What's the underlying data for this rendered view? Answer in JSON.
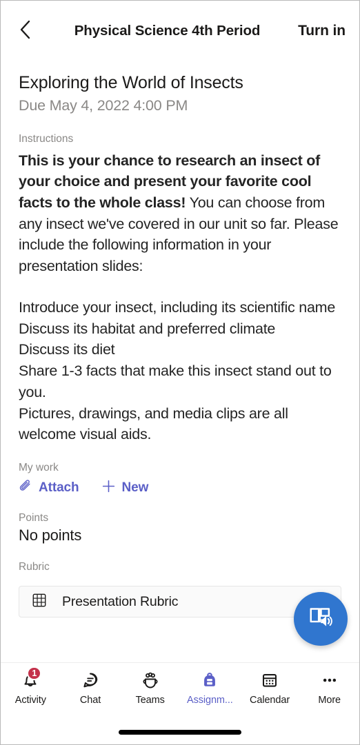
{
  "header": {
    "back_icon": "chevron-left-icon",
    "title": "Physical Science 4th Period",
    "turn_in_label": "Turn in"
  },
  "assignment": {
    "title": "Exploring the World of Insects",
    "due": "Due May 4, 2022 4:00 PM"
  },
  "instructions": {
    "label": "Instructions",
    "bold_text": "This is your chance to research an insect of your choice and present your favorite cool facts to the whole class!",
    "rest_text": " You can choose from any insect we've covered in our unit so far. Please include the following information in your presentation slides:",
    "list": [
      "Introduce your insect, including its scientific name",
      "Discuss its habitat and preferred climate",
      "Discuss its diet",
      "Share 1-3 facts that make this insect stand out to you.",
      "Pictures, drawings, and media clips are all welcome visual aids."
    ]
  },
  "my_work": {
    "label": "My work",
    "actions": [
      {
        "label": "Attach",
        "icon": "paperclip-icon"
      },
      {
        "label": "New",
        "icon": "plus-icon"
      }
    ]
  },
  "points": {
    "label": "Points",
    "value": "No points"
  },
  "rubric": {
    "label": "Rubric",
    "card_label": "Presentation Rubric",
    "card_icon": "grid-icon"
  },
  "fab": {
    "icon": "immersive-reader-icon",
    "color": "#3076cf"
  },
  "bottom_nav": {
    "items": [
      {
        "label": "Activity",
        "icon": "bell-icon",
        "badge": "1",
        "active": false
      },
      {
        "label": "Chat",
        "icon": "chat-icon",
        "badge": "",
        "active": false
      },
      {
        "label": "Teams",
        "icon": "teams-icon",
        "badge": "",
        "active": false
      },
      {
        "label": "Assignm...",
        "icon": "backpack-icon",
        "badge": "",
        "active": true
      },
      {
        "label": "Calendar",
        "icon": "calendar-icon",
        "badge": "",
        "active": false
      },
      {
        "label": "More",
        "icon": "ellipsis-icon",
        "badge": "",
        "active": false
      }
    ]
  },
  "colors": {
    "accent_purple": "#5b5fc7",
    "fab_blue": "#3076cf",
    "badge_red": "#c4314b",
    "text_primary": "#1b1a19",
    "text_secondary": "#8a8886"
  }
}
